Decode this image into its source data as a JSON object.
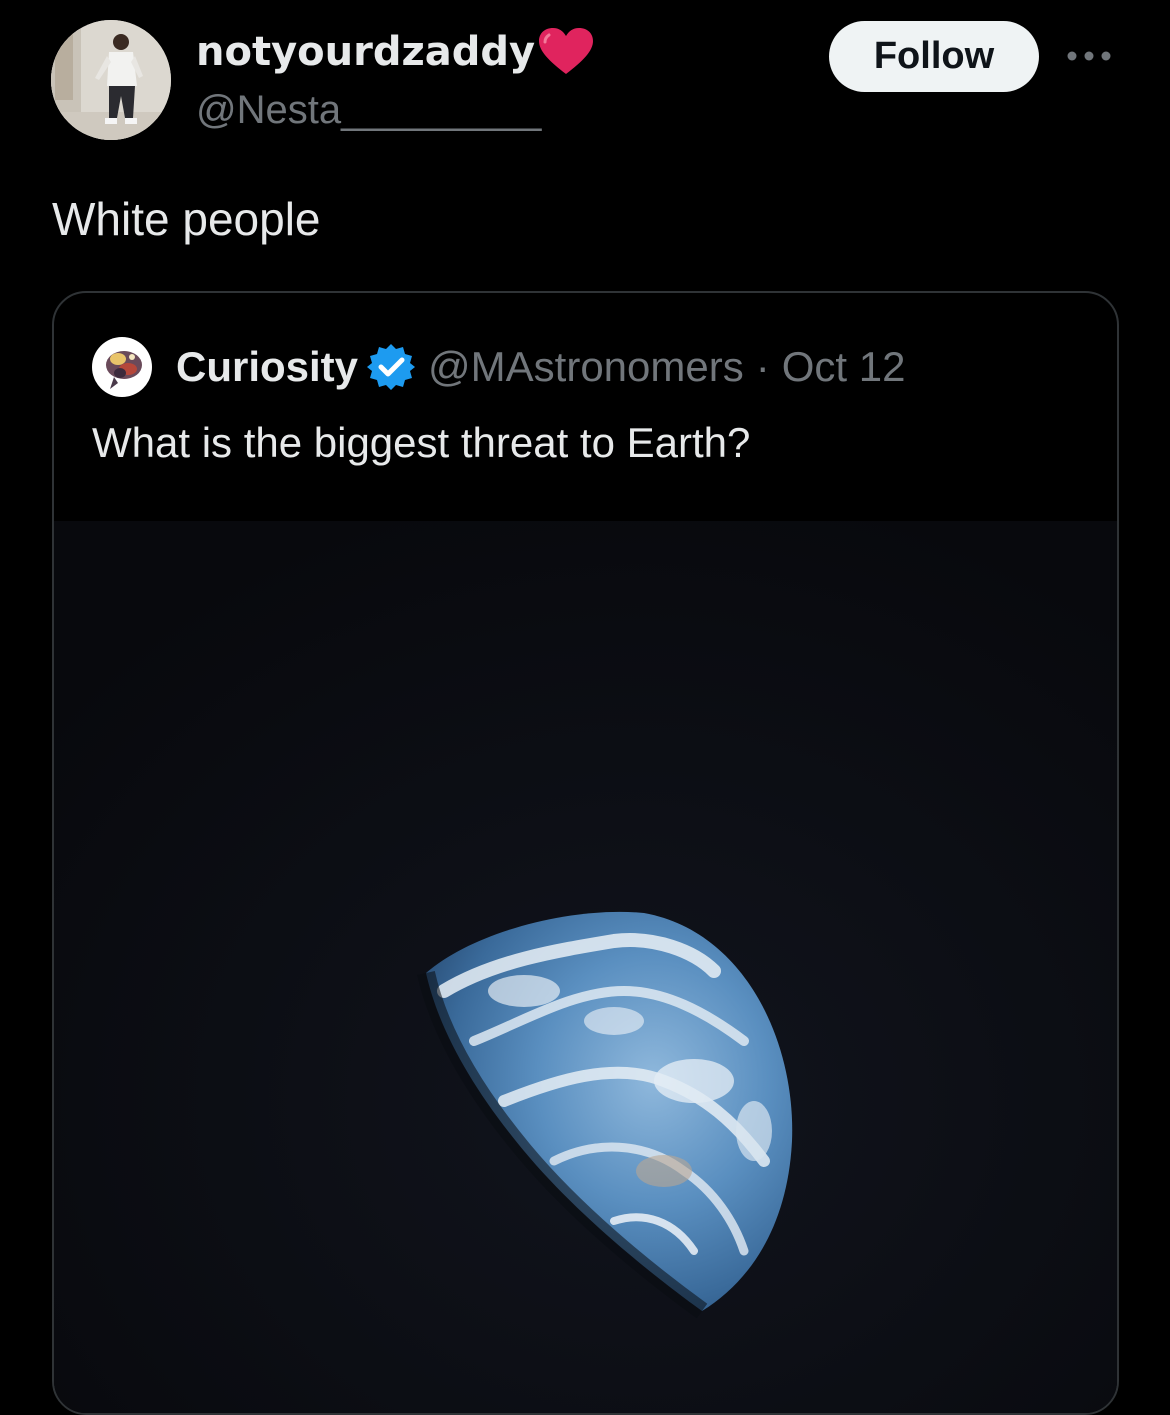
{
  "tweet": {
    "author": {
      "display_name": "notyourdzaddy",
      "handle": "@Nesta_________",
      "avatar_icon": "profile-photo",
      "name_emoji": "red-heart-icon"
    },
    "follow_label": "Follow",
    "more_icon": "ellipsis-icon",
    "text": "White people"
  },
  "quote": {
    "author": {
      "display_name": "Curiosity",
      "handle": "@MAstronomers",
      "verified_icon": "verified-badge-icon"
    },
    "separator": "·",
    "date": "Oct 12",
    "text": "What is the biggest threat to Earth?",
    "media_icon": "earth-from-space-photo"
  },
  "colors": {
    "background": "#000000",
    "text_primary": "#e7e9ea",
    "text_secondary": "#71767b",
    "border": "#2f3336",
    "follow_bg": "#eff3f4",
    "verified_blue": "#1d9bf0",
    "heart_red": "#e0245e"
  }
}
